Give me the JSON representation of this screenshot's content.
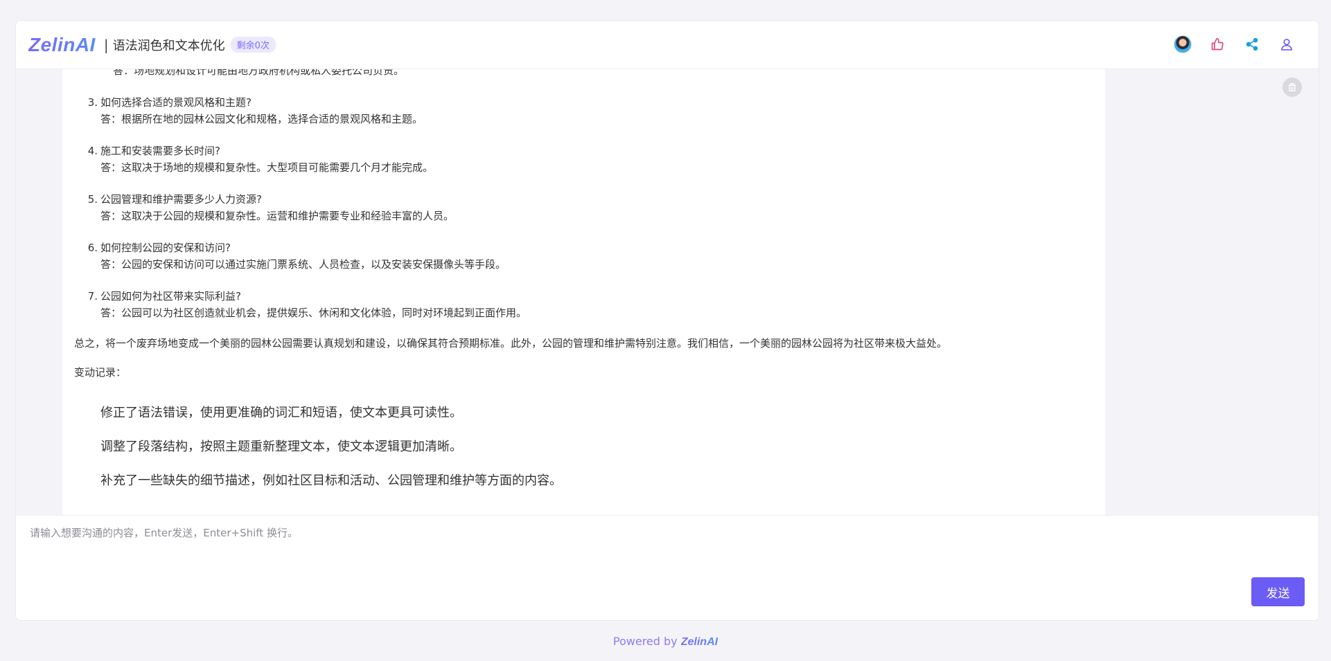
{
  "header": {
    "logo": "ZelinAI",
    "separator": "|",
    "title": "语法润色和文本优化",
    "remaining_badge": "剩余0次",
    "actions": [
      {
        "name": "avatar",
        "icon": "avatar-icon"
      },
      {
        "name": "like",
        "icon": "thumbs-up-icon",
        "color": "#e0457b"
      },
      {
        "name": "share",
        "icon": "share-icon",
        "color": "#1aa0e0"
      },
      {
        "name": "user",
        "icon": "user-icon",
        "color": "#6c5cf6"
      }
    ]
  },
  "message": {
    "cut_line": "答：场地规划和设计可能由地方政府机构或私人委托公司负责。",
    "faq": [
      {
        "num": "3.",
        "q": "如何选择合适的景观风格和主题?",
        "a": "答：根据所在地的园林公园文化和规格，选择合适的景观风格和主题。"
      },
      {
        "num": "4.",
        "q": "施工和安装需要多长时间?",
        "a": "答：这取决于场地的规模和复杂性。大型项目可能需要几个月才能完成。"
      },
      {
        "num": "5.",
        "q": "公园管理和维护需要多少人力资源?",
        "a": "答：这取决于公园的规模和复杂性。运营和维护需要专业和经验丰富的人员。"
      },
      {
        "num": "6.",
        "q": "如何控制公园的安保和访问?",
        "a": "答：公园的安保和访问可以通过实施门票系统、人员检查，以及安装安保摄像头等手段。"
      },
      {
        "num": "7.",
        "q": "公园如何为社区带来实际利益?",
        "a": "答：公园可以为社区创造就业机会，提供娱乐、休闲和文化体验，同时对环境起到正面作用。"
      }
    ],
    "summary": "总之，将一个废弃场地变成一个美丽的园林公园需要认真规划和建设，以确保其符合预期标准。此外，公园的管理和维护需特别注意。我们相信，一个美丽的园林公园将为社区带来极大益处。",
    "changes_label": "变动记录：",
    "changes": [
      "修正了语法错误，使用更准确的词汇和短语，使文本更具可读性。",
      "调整了段落结构，按照主题重新整理文本，使文本逻辑更加清晰。",
      "补充了一些缺失的细节描述，例如社区目标和活动、公园管理和维护等方面的内容。"
    ]
  },
  "input": {
    "placeholder": "请输入想要沟通的内容，Enter发送，Enter+Shift 换行。",
    "value": "",
    "send_label": "发送"
  },
  "footer": {
    "prefix": "Powered by ",
    "brand": "ZelinAI"
  }
}
